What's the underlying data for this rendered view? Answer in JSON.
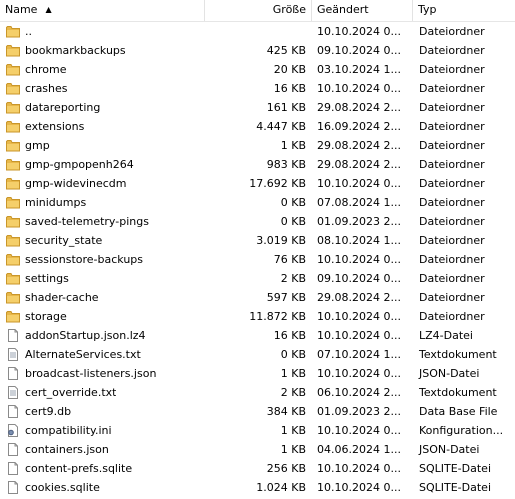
{
  "columns": {
    "name": "Name",
    "size": "Größe",
    "modified": "Geändert",
    "type": "Typ"
  },
  "colors": {
    "folder": "#e8b84a",
    "folder_dark": "#c9962a"
  },
  "rows": [
    {
      "name": "..",
      "size": "",
      "modified": "10.10.2024 0...",
      "type": "Dateiordner",
      "icon": "folder-icon"
    },
    {
      "name": "bookmarkbackups",
      "size": "425 KB",
      "modified": "09.10.2024 0...",
      "type": "Dateiordner",
      "icon": "folder-icon"
    },
    {
      "name": "chrome",
      "size": "20 KB",
      "modified": "03.10.2024 1...",
      "type": "Dateiordner",
      "icon": "folder-icon"
    },
    {
      "name": "crashes",
      "size": "16 KB",
      "modified": "10.10.2024 0...",
      "type": "Dateiordner",
      "icon": "folder-icon"
    },
    {
      "name": "datareporting",
      "size": "161 KB",
      "modified": "29.08.2024 2...",
      "type": "Dateiordner",
      "icon": "folder-icon"
    },
    {
      "name": "extensions",
      "size": "4.447 KB",
      "modified": "16.09.2024 2...",
      "type": "Dateiordner",
      "icon": "folder-icon"
    },
    {
      "name": "gmp",
      "size": "1 KB",
      "modified": "29.08.2024 2...",
      "type": "Dateiordner",
      "icon": "folder-icon"
    },
    {
      "name": "gmp-gmpopenh264",
      "size": "983 KB",
      "modified": "29.08.2024 2...",
      "type": "Dateiordner",
      "icon": "folder-icon"
    },
    {
      "name": "gmp-widevinecdm",
      "size": "17.692 KB",
      "modified": "10.10.2024 0...",
      "type": "Dateiordner",
      "icon": "folder-icon"
    },
    {
      "name": "minidumps",
      "size": "0 KB",
      "modified": "07.08.2024 1...",
      "type": "Dateiordner",
      "icon": "folder-icon"
    },
    {
      "name": "saved-telemetry-pings",
      "size": "0 KB",
      "modified": "01.09.2023 2...",
      "type": "Dateiordner",
      "icon": "folder-icon"
    },
    {
      "name": "security_state",
      "size": "3.019 KB",
      "modified": "08.10.2024 1...",
      "type": "Dateiordner",
      "icon": "folder-icon"
    },
    {
      "name": "sessionstore-backups",
      "size": "76 KB",
      "modified": "10.10.2024 0...",
      "type": "Dateiordner",
      "icon": "folder-icon"
    },
    {
      "name": "settings",
      "size": "2 KB",
      "modified": "09.10.2024 0...",
      "type": "Dateiordner",
      "icon": "folder-icon"
    },
    {
      "name": "shader-cache",
      "size": "597 KB",
      "modified": "29.08.2024 2...",
      "type": "Dateiordner",
      "icon": "folder-icon"
    },
    {
      "name": "storage",
      "size": "11.872 KB",
      "modified": "10.10.2024 0...",
      "type": "Dateiordner",
      "icon": "folder-icon"
    },
    {
      "name": "addonStartup.json.lz4",
      "size": "16 KB",
      "modified": "10.10.2024 0...",
      "type": "LZ4-Datei",
      "icon": "file-icon"
    },
    {
      "name": "AlternateServices.txt",
      "size": "0 KB",
      "modified": "07.10.2024 1...",
      "type": "Textdokument",
      "icon": "text-file-icon"
    },
    {
      "name": "broadcast-listeners.json",
      "size": "1 KB",
      "modified": "10.10.2024 0...",
      "type": "JSON-Datei",
      "icon": "file-icon"
    },
    {
      "name": "cert_override.txt",
      "size": "2 KB",
      "modified": "06.10.2024 2...",
      "type": "Textdokument",
      "icon": "text-file-icon"
    },
    {
      "name": "cert9.db",
      "size": "384 KB",
      "modified": "01.09.2023 2...",
      "type": "Data Base File",
      "icon": "file-icon"
    },
    {
      "name": "compatibility.ini",
      "size": "1 KB",
      "modified": "10.10.2024 0...",
      "type": "Konfiguration...",
      "icon": "settings-file-icon"
    },
    {
      "name": "containers.json",
      "size": "1 KB",
      "modified": "04.06.2024 1...",
      "type": "JSON-Datei",
      "icon": "file-icon"
    },
    {
      "name": "content-prefs.sqlite",
      "size": "256 KB",
      "modified": "10.10.2024 0...",
      "type": "SQLITE-Datei",
      "icon": "file-icon"
    },
    {
      "name": "cookies.sqlite",
      "size": "1.024 KB",
      "modified": "10.10.2024 0...",
      "type": "SQLITE-Datei",
      "icon": "file-icon"
    }
  ]
}
